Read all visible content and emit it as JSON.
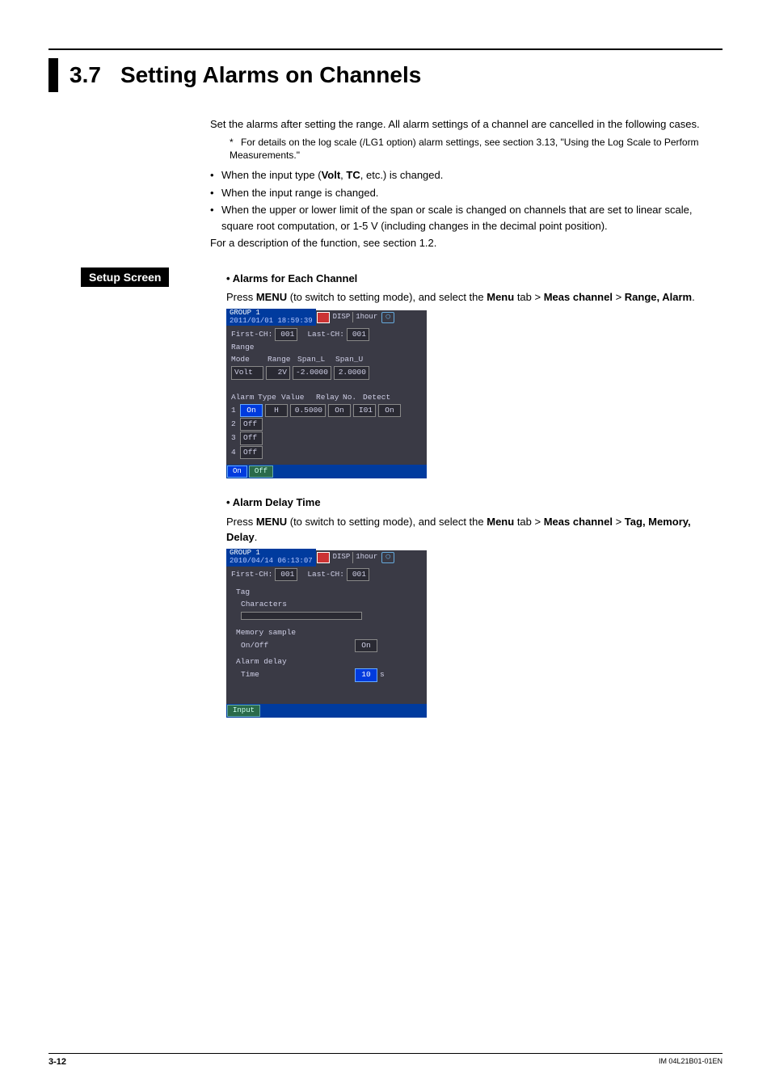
{
  "section": {
    "num": "3.7",
    "title": "Setting Alarms on Channels"
  },
  "intro": {
    "p1": "Set the alarms after setting the range. All alarm settings of a channel are cancelled in the following cases.",
    "footnote": "For details on the log scale (/LG1 option) alarm settings, see section 3.13, \"Using the Log Scale to Perform Measurements.\"",
    "bul1a": "When the input type (",
    "bul1b": "Volt",
    "bul1c": ", ",
    "bul1d": "TC",
    "bul1e": ", etc.) is changed.",
    "bul2": "When the input range is changed.",
    "bul3": "When the upper or lower limit of the span or scale is changed on channels that are set to linear scale, square root computation, or 1-5 V (including changes in the decimal point position).",
    "p2": "For a description of the function, see section 1.2."
  },
  "setup": {
    "label": "Setup Screen"
  },
  "alarms": {
    "heading": "Alarms for Each Channel",
    "p_a": "Press ",
    "p_b": "MENU",
    "p_c": " (to switch to setting mode), and select the ",
    "p_d": "Menu",
    "p_e": " tab > ",
    "p_f": "Meas channel",
    "p_g": " > ",
    "p_h": "Range, Alarm",
    "p_i": "."
  },
  "scr1": {
    "group": "GROUP 1",
    "date": "2011/01/01 18:59:39",
    "disp": "DISP",
    "hour": "1hour",
    "first_ch_l": "First-CH:",
    "first_ch_v": "001",
    "last_ch_l": "Last-CH:",
    "last_ch_v": "001",
    "range_l": "Range",
    "mode_l": "Mode",
    "range2_l": "Range",
    "spanl_l": "Span_L",
    "spanu_l": "Span_U",
    "mode_v": "Volt",
    "range_v": "2V",
    "spanl_v": "-2.0000",
    "spanu_v": "2.0000",
    "alarm_l": "Alarm",
    "type_l": "Type",
    "value_l": "Value",
    "relay_l": "Relay",
    "no_l": "No.",
    "detect_l": "Detect",
    "r1_n": "1",
    "r1_on": "On",
    "r1_type": "H",
    "r1_val": "0.5000",
    "r1_relay": "On",
    "r1_no": "I01",
    "r1_det": "On",
    "r2_n": "2",
    "r2_off": "Off",
    "r3_n": "3",
    "r3_off": "Off",
    "r4_n": "4",
    "r4_off": "Off",
    "foot_on": "On",
    "foot_off": "Off"
  },
  "delay": {
    "heading": "Alarm Delay Time",
    "p_a": "Press ",
    "p_b": "MENU",
    "p_c": " (to switch to setting mode), and select the ",
    "p_d": "Menu",
    "p_e": " tab > ",
    "p_f": "Meas channel",
    "p_g": " > ",
    "p_h": "Tag, Memory, Delay",
    "p_i": "."
  },
  "scr2": {
    "group": "GROUP 1",
    "date": "2010/04/14 06:13:07",
    "disp": "DISP",
    "hour": "1hour",
    "first_ch_l": "First-CH:",
    "first_ch_v": "001",
    "last_ch_l": "Last-CH:",
    "last_ch_v": "001",
    "tag_l": "Tag",
    "chars_l": "Characters",
    "mem_l": "Memory sample",
    "onoff_l": "On/Off",
    "onoff_v": "On",
    "adelay_l": "Alarm delay",
    "time_l": "Time",
    "time_v": "10",
    "time_unit": "s",
    "foot_input": "Input"
  },
  "footer": {
    "page": "3-12",
    "code": "IM 04L21B01-01EN"
  }
}
